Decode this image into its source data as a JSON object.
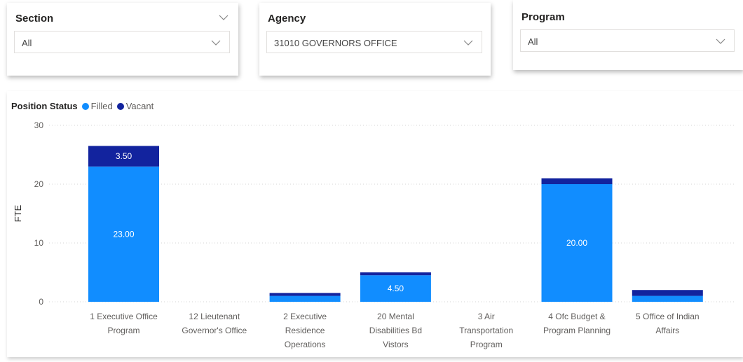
{
  "slicers": {
    "section": {
      "title": "Section",
      "value": "All"
    },
    "agency": {
      "title": "Agency",
      "value": "31010 GOVERNORS OFFICE"
    },
    "program": {
      "title": "Program",
      "value": "All"
    }
  },
  "legend": {
    "title": "Position Status",
    "items": [
      {
        "label": "Filled",
        "color": "#118dff"
      },
      {
        "label": "Vacant",
        "color": "#12239e"
      }
    ]
  },
  "chart_data": {
    "type": "bar",
    "stacked": true,
    "ylabel": "FTE",
    "ylim": [
      0,
      30
    ],
    "yticks": [
      0,
      10,
      20,
      30
    ],
    "grid": true,
    "legend_position": "top-left",
    "categories": [
      [
        "1 Executive Office",
        "Program"
      ],
      [
        "12 Lieutenant",
        "Governor's Office"
      ],
      [
        "2 Executive",
        "Residence",
        "Operations"
      ],
      [
        "20 Mental",
        "Disabilities Bd",
        "Vistors"
      ],
      [
        "3 Air",
        "Transportation",
        "Program"
      ],
      [
        "4 Ofc Budget &",
        "Program Planning"
      ],
      [
        "5 Office of Indian",
        "Affairs"
      ]
    ],
    "series": [
      {
        "name": "Filled",
        "color": "#118dff",
        "values": [
          23.0,
          0,
          1.0,
          4.5,
          0,
          20.0,
          1.0
        ],
        "labels": [
          "23.00",
          null,
          null,
          "4.50",
          null,
          "20.00",
          null
        ]
      },
      {
        "name": "Vacant",
        "color": "#12239e",
        "values": [
          3.5,
          0,
          0.5,
          0.5,
          0,
          1.0,
          1.0
        ],
        "labels": [
          "3.50",
          null,
          null,
          null,
          null,
          null,
          null
        ]
      }
    ]
  }
}
